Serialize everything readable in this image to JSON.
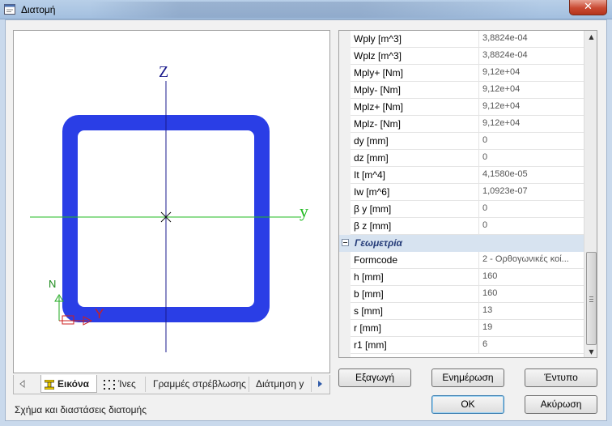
{
  "window": {
    "title": "Διατομή",
    "close_symbol": "✕"
  },
  "preview": {
    "axis_z": "Z",
    "axis_y": "y",
    "gizmo_n": "N",
    "gizmo_y": "Y",
    "colors": {
      "section": "#2a3ee6",
      "z_axis": "#1a1a8c",
      "y_axis": "#22bb22"
    }
  },
  "tabs": [
    {
      "label": "Εικόνα",
      "icon": "i-beam-icon",
      "active": true
    },
    {
      "label": "Ίνες",
      "icon": "dotted-frame-icon",
      "active": false
    },
    {
      "label": "Γραμμές στρέβλωσης",
      "active": false
    },
    {
      "label": "Διάτμηση y",
      "active": false
    }
  ],
  "status_text": "Σχήμα και διαστάσεις διατομής",
  "properties": {
    "rows_top": [
      {
        "name": "Wply [m^3]",
        "value": "3,8824e-04"
      },
      {
        "name": "Wplz [m^3]",
        "value": "3,8824e-04"
      },
      {
        "name": "Mply+ [Nm]",
        "value": "9,12e+04"
      },
      {
        "name": "Mply- [Nm]",
        "value": "9,12e+04"
      },
      {
        "name": "Mplz+ [Nm]",
        "value": "9,12e+04"
      },
      {
        "name": "Mplz- [Nm]",
        "value": "9,12e+04"
      },
      {
        "name": "dy [mm]",
        "value": "0"
      },
      {
        "name": "dz [mm]",
        "value": "0"
      },
      {
        "name": "It [m^4]",
        "value": "4,1580e-05"
      },
      {
        "name": "Iw [m^6]",
        "value": "1,0923e-07"
      },
      {
        "name": "β y [mm]",
        "value": "0"
      },
      {
        "name": "β z [mm]",
        "value": "0"
      }
    ],
    "category": "Γεωμετρία",
    "rows_geometry": [
      {
        "name": "Formcode",
        "value": "2 - Ορθογωνικές κοί..."
      },
      {
        "name": "h [mm]",
        "value": "160"
      },
      {
        "name": "b [mm]",
        "value": "160"
      },
      {
        "name": "s [mm]",
        "value": "13"
      },
      {
        "name": "r [mm]",
        "value": "19"
      },
      {
        "name": "r1 [mm]",
        "value": "6"
      }
    ]
  },
  "buttons": {
    "export": "Εξαγωγή",
    "update": "Ενημέρωση",
    "print": "Έντυπο",
    "ok": "OK",
    "cancel": "Ακύρωση"
  }
}
